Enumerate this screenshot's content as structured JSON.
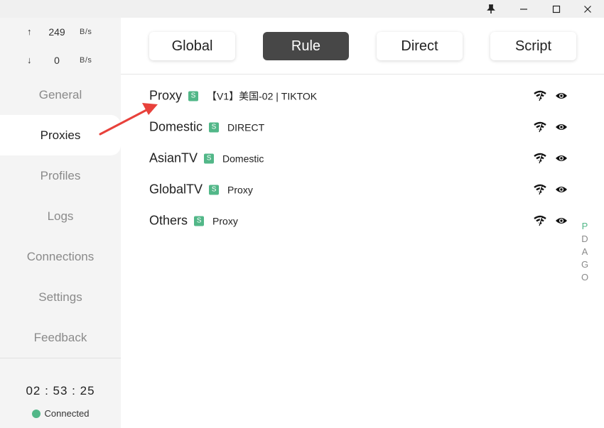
{
  "window": {
    "pin_icon": "pin-icon",
    "minimize_icon": "minimize-icon",
    "maximize_icon": "maximize-icon",
    "close_icon": "close-icon"
  },
  "traffic": {
    "up_arrow": "↑",
    "up_value": "249",
    "up_unit": "B/s",
    "down_arrow": "↓",
    "down_value": "0",
    "down_unit": "B/s"
  },
  "nav": {
    "items": [
      {
        "label": "General"
      },
      {
        "label": "Proxies"
      },
      {
        "label": "Profiles"
      },
      {
        "label": "Logs"
      },
      {
        "label": "Connections"
      },
      {
        "label": "Settings"
      },
      {
        "label": "Feedback"
      }
    ],
    "active": "Proxies"
  },
  "footer": {
    "clock": "02 : 53 : 25",
    "status": "Connected",
    "status_color": "#52b788"
  },
  "modes": {
    "items": [
      {
        "label": "Global"
      },
      {
        "label": "Rule"
      },
      {
        "label": "Direct"
      },
      {
        "label": "Script"
      }
    ],
    "active": "Rule"
  },
  "groups": [
    {
      "name": "Proxy",
      "badge": "S",
      "selected": "【V1】美国-02 | TIKTOK"
    },
    {
      "name": "Domestic",
      "badge": "S",
      "selected": "DIRECT"
    },
    {
      "name": "AsianTV",
      "badge": "S",
      "selected": "Domestic"
    },
    {
      "name": "GlobalTV",
      "badge": "S",
      "selected": "Proxy"
    },
    {
      "name": "Others",
      "badge": "S",
      "selected": "Proxy"
    }
  ],
  "row_icons": {
    "latency_icon": "wifi-signal-icon",
    "view_icon": "eye-icon"
  },
  "scroll_index": [
    "P",
    "D",
    "A",
    "G",
    "O"
  ],
  "colors": {
    "accent": "#52b788",
    "active_mode_bg": "#474747",
    "annotation_arrow": "#e8413b"
  }
}
